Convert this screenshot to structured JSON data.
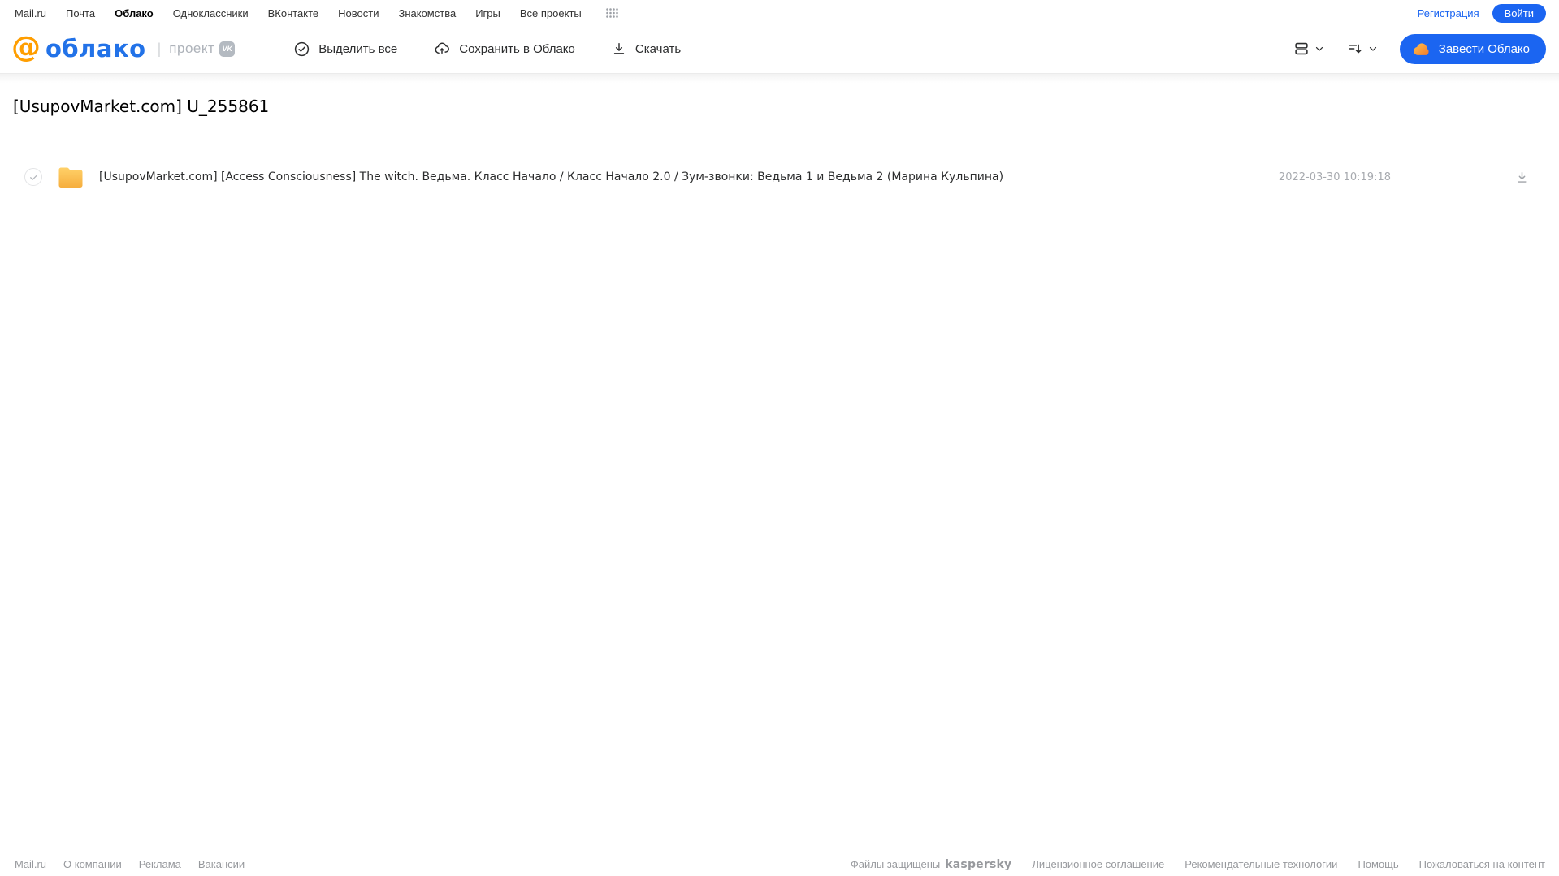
{
  "topnav": {
    "links": [
      {
        "label": "Mail.ru"
      },
      {
        "label": "Почта"
      },
      {
        "label": "Облако"
      },
      {
        "label": "Одноклассники"
      },
      {
        "label": "ВКонтакте"
      },
      {
        "label": "Новости"
      },
      {
        "label": "Знакомства"
      },
      {
        "label": "Игры"
      },
      {
        "label": "Все проекты"
      }
    ],
    "registration": "Регистрация",
    "login": "Войти"
  },
  "header": {
    "logo_at": "@",
    "logo_word": "облако",
    "project_label": "проект",
    "vk_badge": "VK",
    "toolbar": [
      {
        "label": "Выделить все"
      },
      {
        "label": "Сохранить в Облако"
      },
      {
        "label": "Скачать"
      }
    ],
    "create_cloud": "Завести Облако"
  },
  "page": {
    "title": "[UsupovMarket.com] U_255861"
  },
  "files": [
    {
      "name": "[UsupovMarket.com] [Access Consciousness] The witch. Ведьма. Класс Начало / Класс Начало 2.0 / Зум-звонки: Ведьма 1 и Ведьма 2 (Марина Кульпина)",
      "date": "2022-03-30 10:19:18",
      "selected": true
    }
  ],
  "footer": {
    "left": [
      {
        "label": "Mail.ru"
      },
      {
        "label": "О компании"
      },
      {
        "label": "Реклама"
      },
      {
        "label": "Вакансии"
      }
    ],
    "protected_label": "Файлы защищены",
    "kaspersky": "kaspersky",
    "right": [
      {
        "label": "Лицензионное соглашение"
      },
      {
        "label": "Рекомендательные технологии"
      },
      {
        "label": "Помощь"
      },
      {
        "label": "Пожаловаться на контент"
      }
    ]
  },
  "colors": {
    "accent_blue": "#1b65f1",
    "logo_blue": "#2272e8",
    "logo_orange": "#ff9e00",
    "folder_yellow_top": "#ffd169",
    "folder_yellow_bottom": "#f6ae3e",
    "kaspersky_teal": "#00a88e",
    "muted_gray": "#97999d"
  }
}
